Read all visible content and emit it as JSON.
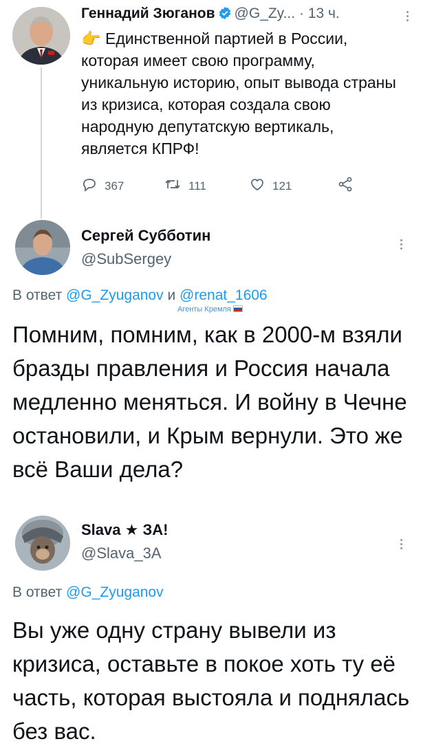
{
  "tweets": [
    {
      "author_name": "Геннадий Зюганов",
      "handle": "@G_Zy...",
      "separator": "·",
      "time": "13 ч.",
      "emoji": "👉",
      "text": "Единственной партией в России, которая имеет свою программу, уникальную историю, опыт вывода страны из кризиса, которая создала свою народную депутатскую вертикаль, является КПРФ!",
      "replies": "367",
      "retweets": "111",
      "likes": "121"
    },
    {
      "author_name": "Сергей Субботин",
      "handle": "@SubSergey",
      "reply_prefix": "В ответ",
      "reply_to_1": "@G_Zyuganov",
      "reply_and": "и",
      "reply_to_2": "@renat_1606",
      "watermark": "Агенты Кремля",
      "text": "Помним, помним, как в 2000-м взяли бразды правления и Россия начала медленно меняться. И войну в Чечне остановили, и Крым вернули. Это же всё Ваши дела?"
    },
    {
      "author_name": "Slava ★ ЗА!",
      "handle": "@Slava_3A",
      "reply_prefix": "В ответ",
      "reply_to_1": "@G_Zyuganov",
      "text": "Вы уже одну страну вывели из кризиса, оставьте в покое хоть ту её часть, которая выстояла и поднялась без вас."
    }
  ],
  "colors": {
    "accent": "#1d9bf0",
    "muted": "#536471",
    "text": "#0f1419"
  },
  "icons": [
    "verified-icon",
    "reply-icon",
    "retweet-icon",
    "like-icon",
    "share-icon",
    "more-icon"
  ]
}
